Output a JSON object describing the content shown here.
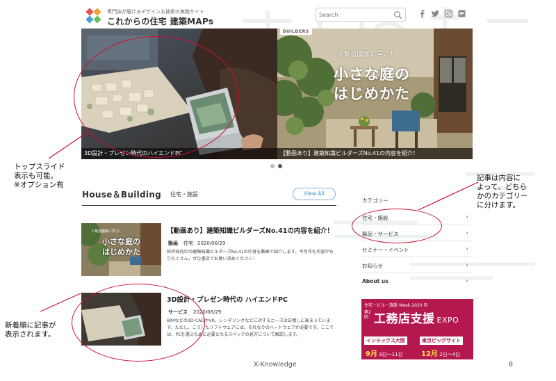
{
  "header": {
    "logo_tagline": "専門誌が届けるデザイン＆技術の実務サイト",
    "logo_name": "これからの住宅 建築MAPs",
    "search_placeholder": "Search",
    "social_icons": [
      "facebook-icon",
      "twitter-icon",
      "instagram-icon",
      "feed-icon"
    ]
  },
  "hero": {
    "slides": [
      {
        "caption": "3D設計・プレゼン時代のハイエンドPC"
      },
      {
        "badge": "BUILDERS",
        "kicker": "人気造園家に学ぶ！",
        "title_line1": "小さな庭の",
        "title_line2": "はじめかた",
        "caption": "【動画あり】建築知識ビルダーズNo.41の内容を紹介！"
      }
    ],
    "dots": 2,
    "active_dot": 1
  },
  "section": {
    "title": "House＆Building",
    "subtitle": "住宅・施設",
    "view_all_label": "View All"
  },
  "articles": [
    {
      "title": "【動画あり】建築知識ビルダーズNo.41の内容を紹介！",
      "category": "動画",
      "subcategory": "住宅",
      "date": "2020/06/29",
      "thumb_kicker": "人気造園家に学ぶ！",
      "thumb_title1": "小さな庭の",
      "thumb_title2": "はじめかた",
      "description": "好評発売中の建築知識ビルダーズNo.41の中身を動画で紹介します。今月号も内容がもりだくさん。ぜひ書店でお買い求めください！"
    },
    {
      "title": "3D設計・プレゼン時代の ハイエンドPC",
      "category": "サービス",
      "date": "2020/06/29",
      "description": "BIMなどの3D-CADやVR、レンダリングなどに対するニーズは日増しに高まっています。ただし、こうしたソフトウェアには、それなりのハードウェアが必要です。ここでは、PCを選ぶために必要となるスペックの見方について解説します。"
    }
  ],
  "sidebar": {
    "heading": "カテゴリー",
    "items": [
      {
        "label": "住宅・施設"
      },
      {
        "label": "製品・サービス"
      },
      {
        "label": "セミナー・イベント"
      },
      {
        "label": "お知らせ"
      },
      {
        "label": "About us"
      }
    ]
  },
  "ad": {
    "top_line": "住宅・ビル・施設 Week 2020 内",
    "edition": "第2回",
    "main": "工務店支援",
    "expo": "EXPO",
    "tag1": "インテックス大阪",
    "tag2": "東京ビッグサイト",
    "date1_month": "9月",
    "date1_days": "9日〜11日",
    "date2_month": "12月",
    "date2_days": "2日〜4日"
  },
  "annotations": {
    "top_slide": [
      "トップスライド",
      "表示も可能。",
      "※オプション有"
    ],
    "category": [
      "記事は内容に",
      "よって、どちら",
      "かのカテゴリー",
      "に分けます。"
    ],
    "new_order": [
      "新着順に記事が",
      "表示されます。"
    ]
  },
  "footer": {
    "publisher": "X-Knowledge",
    "page_number": "8"
  },
  "colors": {
    "accent_blue": "#3d8bd1",
    "annotation_red": "#cc1133",
    "ad_magenta": "#b5174f",
    "ad_yellow": "#ffe24a"
  }
}
